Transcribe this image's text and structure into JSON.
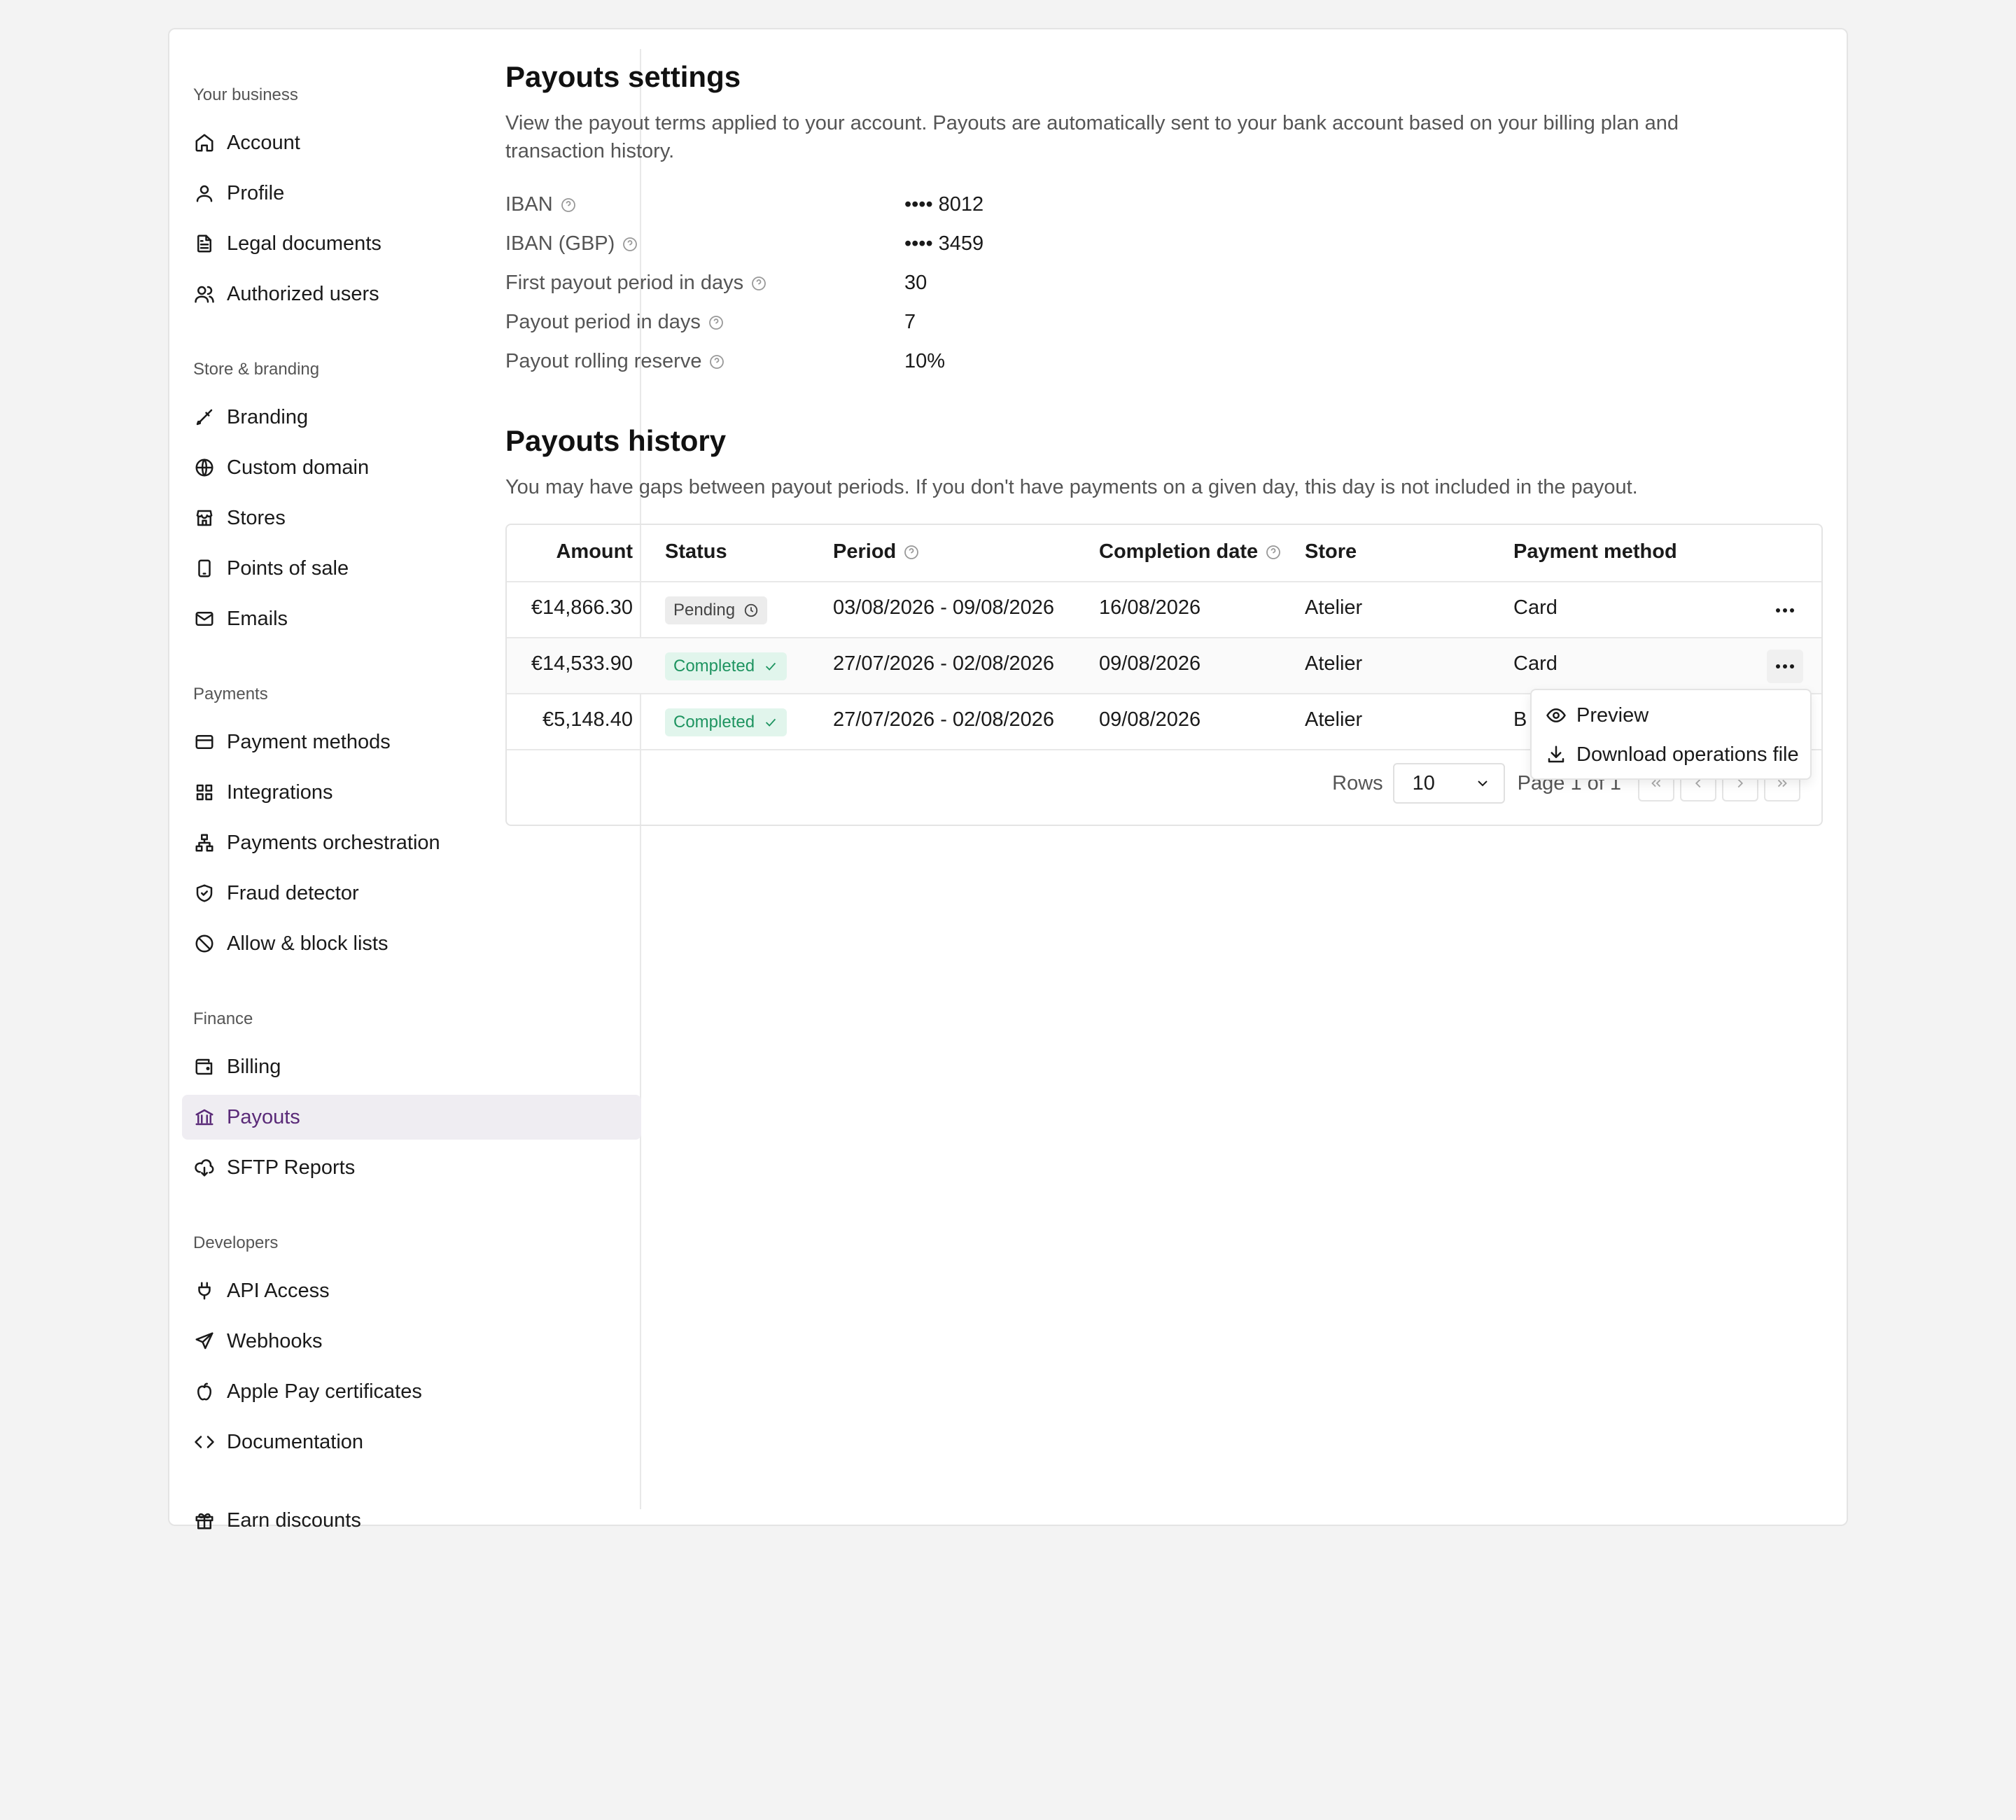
{
  "sidebar": {
    "sections": [
      {
        "title": "Your business",
        "items": [
          "Account",
          "Profile",
          "Legal documents",
          "Authorized users"
        ]
      },
      {
        "title": "Store & branding",
        "items": [
          "Branding",
          "Custom domain",
          "Stores",
          "Points of sale",
          "Emails"
        ]
      },
      {
        "title": "Payments",
        "items": [
          "Payment methods",
          "Integrations",
          "Payments orchestration",
          "Fraud detector",
          "Allow & block lists"
        ]
      },
      {
        "title": "Finance",
        "items": [
          "Billing",
          "Payouts",
          "SFTP Reports"
        ]
      },
      {
        "title": "Developers",
        "items": [
          "API Access",
          "Webhooks",
          "Apple Pay certificates",
          "Documentation"
        ]
      }
    ],
    "footer_item": "Earn discounts",
    "active": "Payouts",
    "active_color": "#5a2a78"
  },
  "settings": {
    "title": "Payouts settings",
    "description": "View the payout terms applied to your account. Payouts are automatically sent to your bank account based on your billing plan and transaction history.",
    "rows": [
      {
        "label": "IBAN",
        "value": "•••• 8012"
      },
      {
        "label": "IBAN (GBP)",
        "value": "•••• 3459"
      },
      {
        "label": "First payout period in days",
        "value": "30"
      },
      {
        "label": "Payout period in days",
        "value": "7"
      },
      {
        "label": "Payout rolling reserve",
        "value": "10%"
      }
    ]
  },
  "history": {
    "title": "Payouts history",
    "description": "You may have gaps between payout periods. If you don't have payments on a given day, this day is not included in the payout.",
    "columns": {
      "amount": "Amount",
      "status": "Status",
      "period": "Period",
      "completion": "Completion date",
      "store": "Store",
      "method": "Payment method"
    },
    "rows": [
      {
        "amount": "€14,866.30",
        "status": "Pending",
        "period": "03/08/2026 - 09/08/2026",
        "completion": "16/08/2026",
        "store": "Atelier",
        "method": "Card"
      },
      {
        "amount": "€14,533.90",
        "status": "Completed",
        "period": "27/07/2026 - 02/08/2026",
        "completion": "09/08/2026",
        "store": "Atelier",
        "method": "Card"
      },
      {
        "amount": "€5,148.40",
        "status": "Completed",
        "period": "27/07/2026 - 02/08/2026",
        "completion": "09/08/2026",
        "store": "Atelier",
        "method": "B"
      }
    ],
    "menu": {
      "preview": "Preview",
      "download": "Download operations file"
    },
    "pagination": {
      "rows_label": "Rows",
      "rows_value": "10",
      "page_info": "Page 1 of 1"
    }
  },
  "colors": {
    "pending_bg": "#ececec",
    "completed_bg": "#e1f5ec",
    "completed_text": "#1e9460"
  }
}
